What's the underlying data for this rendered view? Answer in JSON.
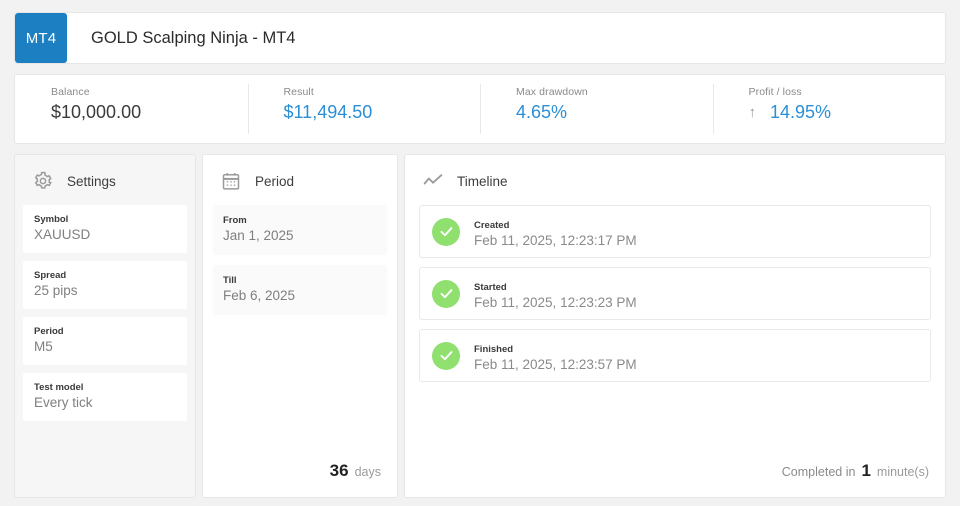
{
  "header": {
    "badge": "MT4",
    "title": "GOLD Scalping Ninja - MT4",
    "badge_color": "#1b7fc1"
  },
  "stats": [
    {
      "label": "Balance",
      "value": "$10,000.00",
      "accent": false,
      "arrow": ""
    },
    {
      "label": "Result",
      "value": "$11,494.50",
      "accent": true,
      "arrow": ""
    },
    {
      "label": "Max drawdown",
      "value": "4.65%",
      "accent": true,
      "arrow": ""
    },
    {
      "label": "Profit / loss",
      "value": "14.95%",
      "accent": true,
      "arrow": "↑"
    }
  ],
  "settings": {
    "title": "Settings",
    "icon": "gear-icon",
    "fields": [
      {
        "label": "Symbol",
        "value": "XAUUSD"
      },
      {
        "label": "Spread",
        "value": "25 pips"
      },
      {
        "label": "Period",
        "value": "M5"
      },
      {
        "label": "Test model",
        "value": "Every tick"
      }
    ]
  },
  "period": {
    "title": "Period",
    "icon": "calendar-icon",
    "fields": [
      {
        "label": "From",
        "value": "Jan 1, 2025"
      },
      {
        "label": "Till",
        "value": "Feb 6, 2025"
      }
    ],
    "duration_value": "36",
    "duration_unit": "days"
  },
  "timeline": {
    "title": "Timeline",
    "icon": "line-chart-icon",
    "events": [
      {
        "label": "Created",
        "time": "Feb 11, 2025, 12:23:17 PM",
        "status": "check"
      },
      {
        "label": "Started",
        "time": "Feb 11, 2025, 12:23:23 PM",
        "status": "check"
      },
      {
        "label": "Finished",
        "time": "Feb 11, 2025, 12:23:57 PM",
        "status": "check"
      }
    ],
    "completed_prefix": "Completed in",
    "completed_value": "1",
    "completed_unit": "minute(s)",
    "check_color": "#8fe06e"
  },
  "colors": {
    "accent": "#2b8fd6",
    "page_bg": "#f2f2f2"
  }
}
